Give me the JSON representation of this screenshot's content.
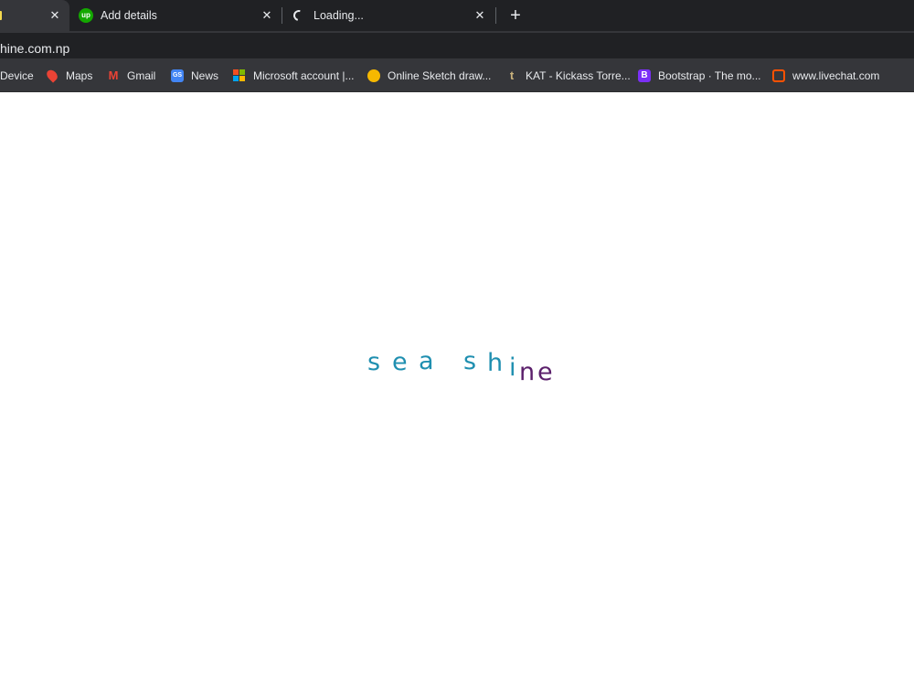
{
  "tabs": [
    {
      "title": "",
      "icon": "yellow-favicon-icon",
      "active": true
    },
    {
      "title": "Add details",
      "icon": "upwork-icon"
    },
    {
      "title": "Loading...",
      "icon": "loading-spinner-icon"
    }
  ],
  "upwork_icon_text": "up",
  "close_glyph": "✕",
  "new_tab_glyph": "+",
  "address_bar": {
    "url": "hine.com.np"
  },
  "bookmarks": [
    {
      "label": "Device"
    },
    {
      "label": "Maps",
      "icon": "maps-icon"
    },
    {
      "label": "Gmail",
      "icon": "gmail-icon",
      "glyph": "M"
    },
    {
      "label": "News",
      "icon": "news-icon",
      "glyph": "GS"
    },
    {
      "label": "Microsoft account |...",
      "icon": "microsoft-icon"
    },
    {
      "label": "Online Sketch draw...",
      "icon": "sketch-icon"
    },
    {
      "label": "KAT - Kickass Torre...",
      "icon": "kat-icon",
      "glyph": "t"
    },
    {
      "label": "Bootstrap · The mo...",
      "icon": "bootstrap-icon",
      "glyph": "B"
    },
    {
      "label": "www.livechat.com",
      "icon": "livechat-icon"
    }
  ],
  "page": {
    "logo_letters": [
      "s",
      "e",
      "a",
      "s",
      "h",
      "i",
      "n",
      "e"
    ],
    "colors": {
      "teal": "#1f8fb0",
      "purple": "#5b1f6b"
    }
  },
  "theme": {
    "tabstrip": "#202124",
    "toolbar": "#35363a",
    "text": "#e8eaed"
  }
}
